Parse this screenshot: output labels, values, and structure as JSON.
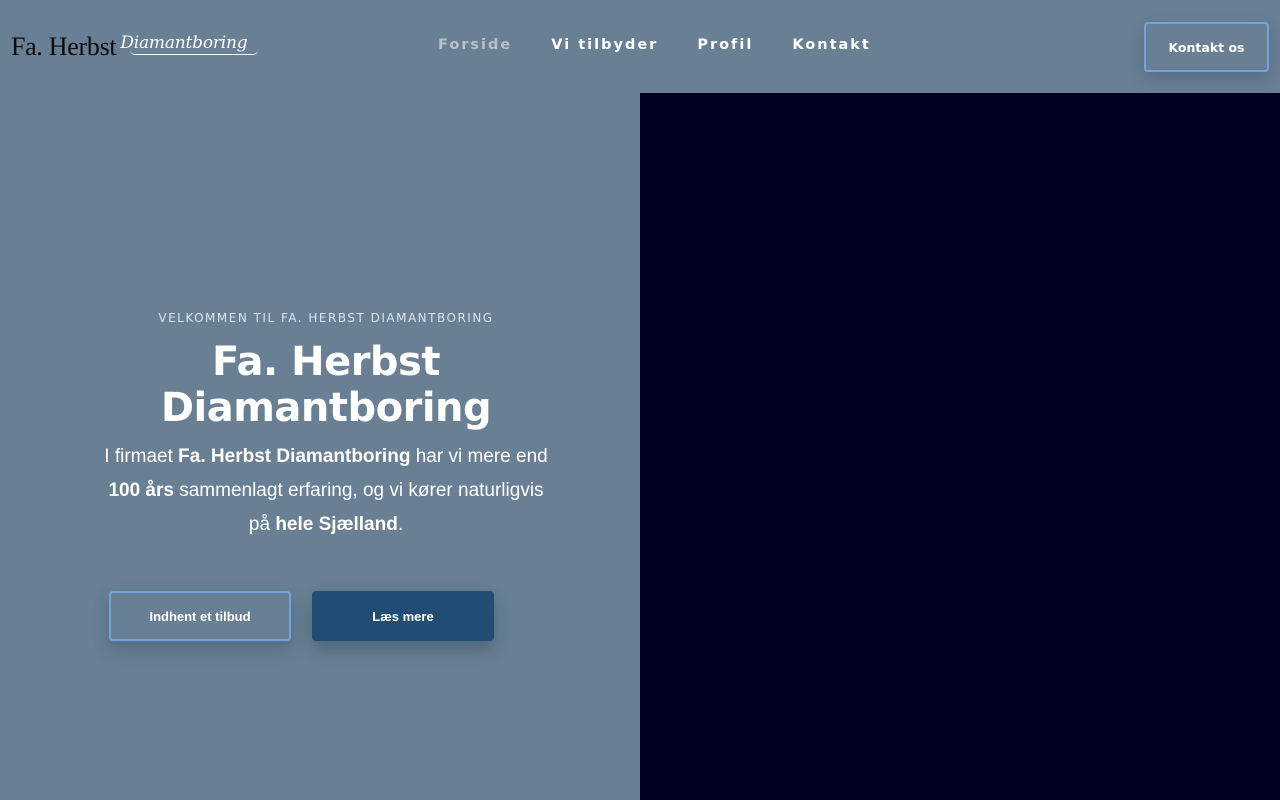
{
  "header": {
    "logo": {
      "serif_text": "Fa. Herbst",
      "script_text": "Diamantboring"
    },
    "nav": [
      {
        "label": "Forside",
        "active": true
      },
      {
        "label": "Vi tilbyder",
        "active": false
      },
      {
        "label": "Profil",
        "active": false
      },
      {
        "label": "Kontakt",
        "active": false
      }
    ],
    "cta_label": "Kontakt os"
  },
  "hero": {
    "eyebrow": "VELKOMMEN TIL FA. HERBST DIAMANTBORING",
    "title_line1": "Fa. Herbst",
    "title_line2": "Diamantboring",
    "description": {
      "p1": "I firmaet ",
      "b1": "Fa. Herbst Diamantboring",
      "p2": " har vi mere end ",
      "b2": "100 års",
      "p3": " sammenlagt erfaring, og vi kører naturligvis på ",
      "b3": "hele Sjælland",
      "p4": "."
    },
    "buttons": {
      "primary_outline": "Indhent et tilbud",
      "secondary_solid": "Læs mere"
    }
  },
  "colors": {
    "background": "#687f94",
    "media_panel": "#000022",
    "accent_border": "#6fa4e0",
    "solid_button": "#214c74"
  }
}
